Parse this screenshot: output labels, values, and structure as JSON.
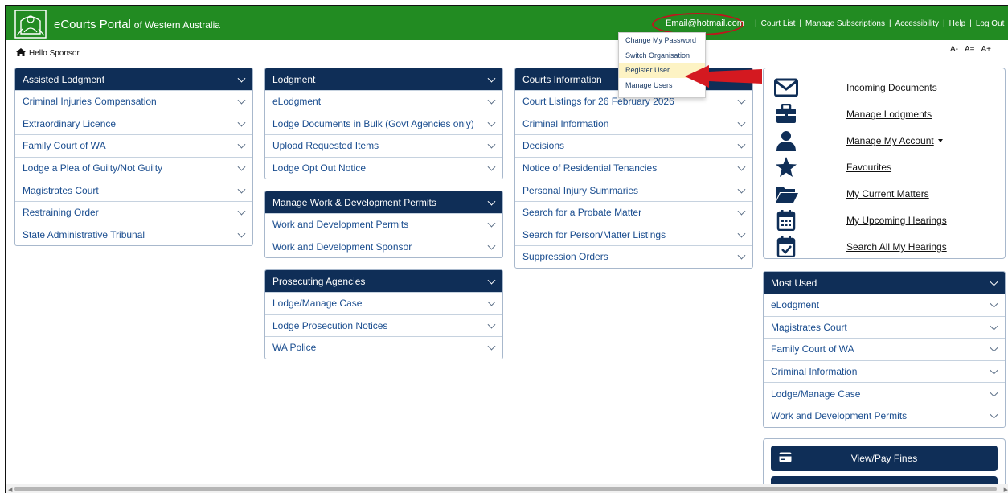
{
  "header": {
    "brand_main": "eCourts Portal",
    "brand_sub": "of Western Australia",
    "user_email": "Email@hotmail.com",
    "links": [
      "Court List",
      "Manage Subscriptions",
      "Accessibility",
      "Help",
      "Log Out"
    ],
    "separator": "|"
  },
  "greeting": "Hello Sponsor",
  "font_controls": [
    "A-",
    "A=",
    "A+"
  ],
  "account_menu": [
    "Change My Password",
    "Switch Organisation",
    "Register User",
    "Manage Users"
  ],
  "panels": {
    "assisted": {
      "title": "Assisted Lodgment",
      "items": [
        "Criminal Injuries Compensation",
        "Extraordinary Licence",
        "Family Court of WA",
        "Lodge a Plea of Guilty/Not Guilty",
        "Magistrates Court",
        "Restraining Order",
        "State Administrative Tribunal"
      ]
    },
    "lodgment": {
      "title": "Lodgment",
      "items": [
        "eLodgment",
        "Lodge Documents in Bulk (Govt Agencies only)",
        "Upload Requested Items",
        "Lodge Opt Out Notice"
      ]
    },
    "permits": {
      "title": "Manage Work & Development Permits",
      "items": [
        "Work and Development Permits",
        "Work and Development Sponsor"
      ]
    },
    "prosecuting": {
      "title": "Prosecuting Agencies",
      "items": [
        "Lodge/Manage Case",
        "Lodge Prosecution Notices",
        "WA Police"
      ]
    },
    "courts": {
      "title": "Courts Information",
      "items": [
        "Court Listings for 26 February 2026",
        "Criminal Information",
        "Decisions",
        "Notice of Residential Tenancies",
        "Personal Injury Summaries",
        "Search for a Probate Matter",
        "Search for Person/Matter Listings",
        "Suppression Orders"
      ]
    },
    "most_used": {
      "title": "Most Used",
      "items": [
        "eLodgment",
        "Magistrates Court",
        "Family Court of WA",
        "Criminal Information",
        "Lodge/Manage Case",
        "Work and Development Permits"
      ]
    }
  },
  "quick_links": [
    {
      "label": "Incoming Documents",
      "icon": "envelope-icon"
    },
    {
      "label": "Manage Lodgments",
      "icon": "briefcase-icon"
    },
    {
      "label": "Manage My Account",
      "icon": "user-icon"
    },
    {
      "label": "Favourites",
      "icon": "star-icon"
    },
    {
      "label": "My Current Matters",
      "icon": "folder-open-icon"
    },
    {
      "label": "My Upcoming Hearings",
      "icon": "calendar-icon"
    },
    {
      "label": "Search All My Hearings",
      "icon": "calendar-check-icon"
    }
  ],
  "fines_button": "View/Pay Fines",
  "colors": {
    "header_green": "#228b22",
    "panel_navy": "#0f2e57",
    "link_blue": "#1a4d8f",
    "annotation_red": "#d41920",
    "highlight_yellow": "#fdf3c4"
  }
}
